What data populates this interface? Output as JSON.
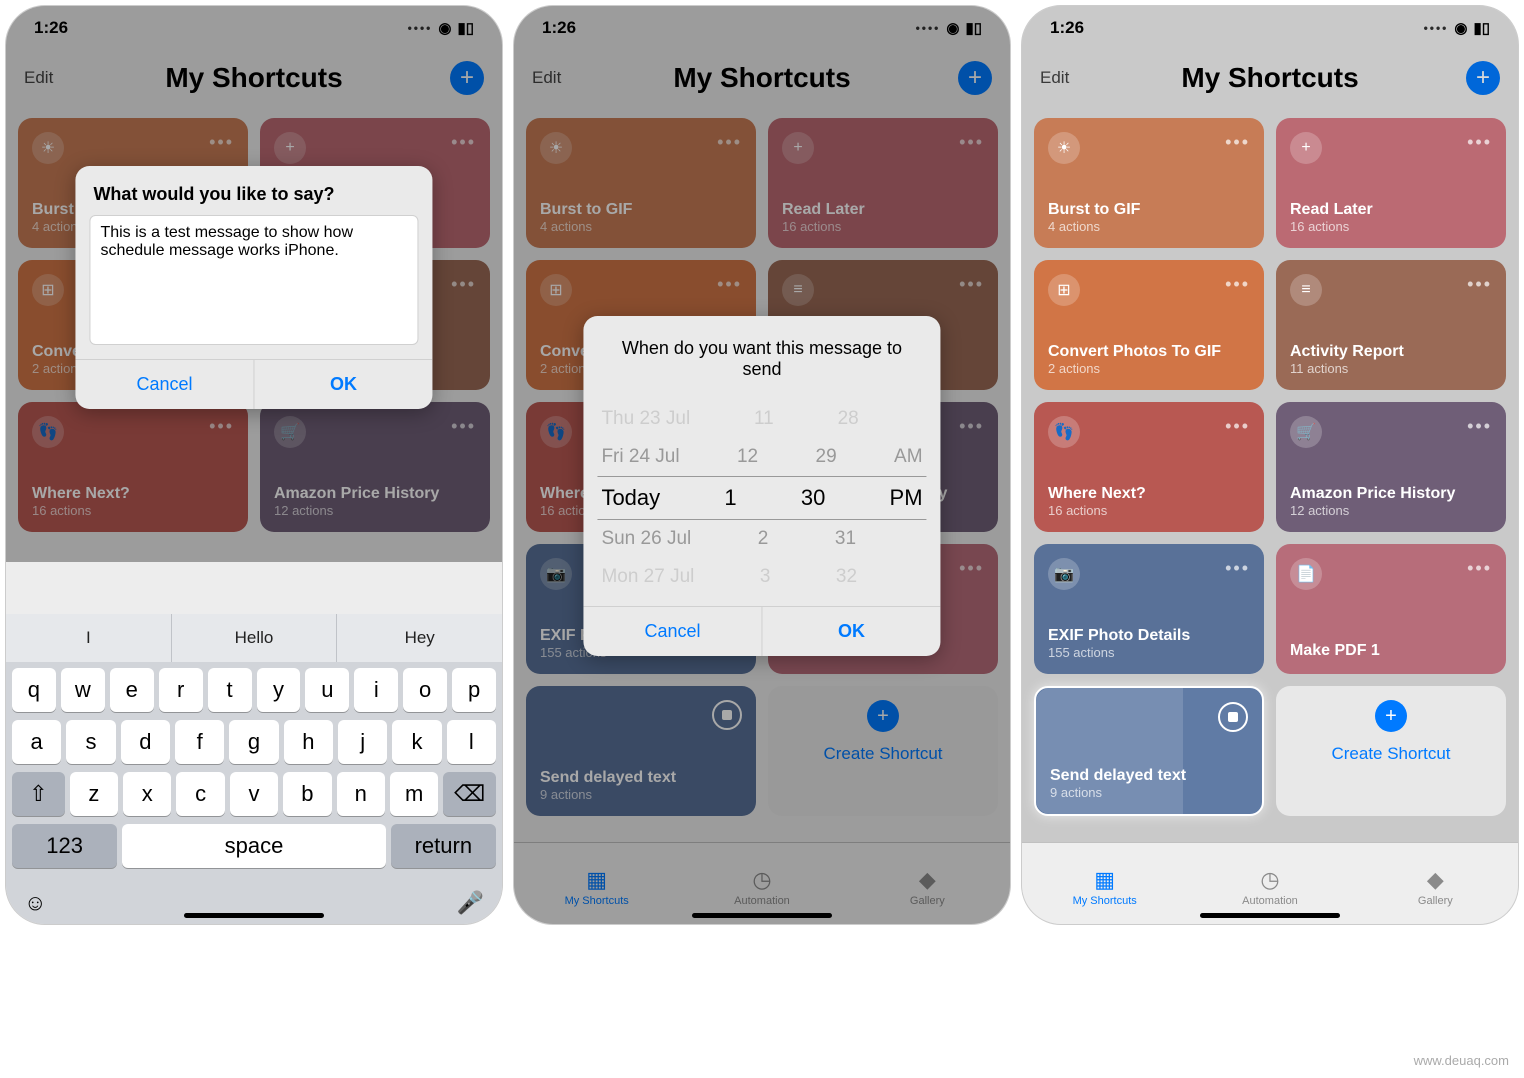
{
  "status": {
    "time": "1:26"
  },
  "nav": {
    "edit": "Edit",
    "title": "My Shortcuts"
  },
  "shortcuts": {
    "burst": {
      "title": "Burst to GIF",
      "sub": "4 actions"
    },
    "read": {
      "title": "Read Later",
      "sub": "16 actions"
    },
    "convert": {
      "title": "Convert Photos To GIF",
      "sub": "2 actions"
    },
    "activity": {
      "title": "Activity Report",
      "sub": "11 actions"
    },
    "where": {
      "title": "Where Next?",
      "sub": "16 actions"
    },
    "amazon": {
      "title": "Amazon Price History",
      "sub": "12 actions"
    },
    "exif": {
      "title": "EXIF Photo Details",
      "sub": "155 actions"
    },
    "makepdf": {
      "title": "Make PDF 1",
      "sub": ""
    },
    "delayed": {
      "title": "Send delayed text",
      "sub": "9 actions"
    },
    "create": {
      "label": "Create Shortcut"
    }
  },
  "alert1": {
    "title": "What would you like to say?",
    "text": "This is a test message to show how schedule message works iPhone.",
    "cancel": "Cancel",
    "ok": "OK"
  },
  "alert2": {
    "title": "When do you want this message to send",
    "picker": {
      "r0": {
        "d": "Thu 23 Jul",
        "h": "11",
        "m": "28",
        "p": ""
      },
      "r1": {
        "d": "Fri 24 Jul",
        "h": "12",
        "m": "29",
        "p": "AM"
      },
      "r2": {
        "d": "Today",
        "h": "1",
        "m": "30",
        "p": "PM"
      },
      "r3": {
        "d": "Sun 26 Jul",
        "h": "2",
        "m": "31",
        "p": ""
      },
      "r4": {
        "d": "Mon 27 Jul",
        "h": "3",
        "m": "32",
        "p": ""
      }
    },
    "cancel": "Cancel",
    "ok": "OK"
  },
  "kb": {
    "sug1": "I",
    "sug2": "Hello",
    "sug3": "Hey",
    "row1": [
      "q",
      "w",
      "e",
      "r",
      "t",
      "y",
      "u",
      "i",
      "o",
      "p"
    ],
    "row2": [
      "a",
      "s",
      "d",
      "f",
      "g",
      "h",
      "j",
      "k",
      "l"
    ],
    "row3": [
      "z",
      "x",
      "c",
      "v",
      "b",
      "n",
      "m"
    ],
    "num": "123",
    "space": "space",
    "ret": "return"
  },
  "tabs": {
    "shortcuts": "My Shortcuts",
    "automation": "Automation",
    "gallery": "Gallery"
  },
  "watermark": "www.deuaq.com"
}
